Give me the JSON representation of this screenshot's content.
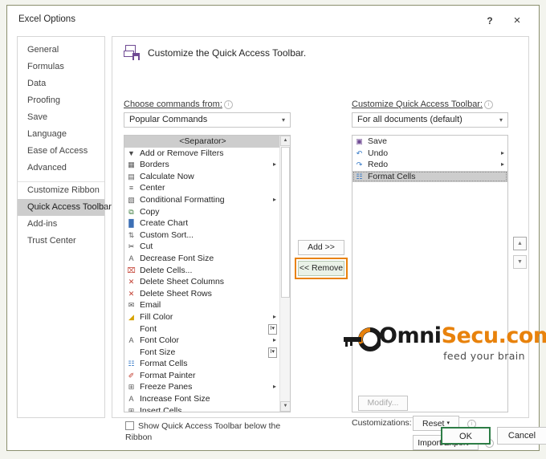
{
  "window": {
    "title": "Excel Options",
    "help_icon": "?",
    "close_icon": "×"
  },
  "sidebar": {
    "items": [
      {
        "label": "General",
        "active": false
      },
      {
        "label": "Formulas",
        "active": false
      },
      {
        "label": "Data",
        "active": false
      },
      {
        "label": "Proofing",
        "active": false
      },
      {
        "label": "Save",
        "active": false
      },
      {
        "label": "Language",
        "active": false
      },
      {
        "label": "Ease of Access",
        "active": false
      },
      {
        "label": "Advanced",
        "active": false
      },
      {
        "label": "Customize Ribbon",
        "active": false
      },
      {
        "label": "Quick Access Toolbar",
        "active": true
      },
      {
        "label": "Add-ins",
        "active": false
      },
      {
        "label": "Trust Center",
        "active": false
      }
    ]
  },
  "main": {
    "header_title": "Customize the Quick Access Toolbar.",
    "header_icon": "print-save-icon",
    "choose_commands_label": "Choose commands from:",
    "choose_commands_value": "Popular Commands",
    "customize_qat_label": "Customize Quick Access Toolbar:",
    "customize_qat_value": "For all documents (default)",
    "commands": [
      {
        "label": "<Separator>",
        "icon": "",
        "separator": true,
        "selected": true
      },
      {
        "label": "Add or Remove Filters",
        "icon": "filter-icon"
      },
      {
        "label": "Borders",
        "icon": "borders-icon",
        "submenu": "▸",
        "split": true
      },
      {
        "label": "Calculate Now",
        "icon": "calculator-icon"
      },
      {
        "label": "Center",
        "icon": "align-center-icon"
      },
      {
        "label": "Conditional Formatting",
        "icon": "conditional-formatting-icon",
        "submenu": "▸"
      },
      {
        "label": "Copy",
        "icon": "copy-icon"
      },
      {
        "label": "Create Chart",
        "icon": "chart-icon"
      },
      {
        "label": "Custom Sort...",
        "icon": "sort-icon"
      },
      {
        "label": "Cut",
        "icon": "scissors-icon"
      },
      {
        "label": "Decrease Font Size",
        "icon": "decrease-font-icon"
      },
      {
        "label": "Delete Cells...",
        "icon": "delete-cells-icon"
      },
      {
        "label": "Delete Sheet Columns",
        "icon": "delete-columns-icon"
      },
      {
        "label": "Delete Sheet Rows",
        "icon": "delete-rows-icon"
      },
      {
        "label": "Email",
        "icon": "email-icon"
      },
      {
        "label": "Fill Color",
        "icon": "fill-color-icon",
        "submenu": "▸",
        "split": true
      },
      {
        "label": "Font",
        "icon": "",
        "combobox": "I▾"
      },
      {
        "label": "Font Color",
        "icon": "font-color-icon",
        "submenu": "▸",
        "split": true
      },
      {
        "label": "Font Size",
        "icon": "",
        "combobox": "I▾"
      },
      {
        "label": "Format Cells",
        "icon": "format-cells-icon"
      },
      {
        "label": "Format Painter",
        "icon": "format-painter-icon"
      },
      {
        "label": "Freeze Panes",
        "icon": "freeze-panes-icon",
        "submenu": "▸"
      },
      {
        "label": "Increase Font Size",
        "icon": "increase-font-icon"
      },
      {
        "label": "Insert Cells...",
        "icon": "insert-cells-icon"
      }
    ],
    "qat_items": [
      {
        "label": "Save",
        "icon": "save-icon",
        "selected": false
      },
      {
        "label": "Undo",
        "icon": "undo-icon",
        "submenu": "▸",
        "selected": false
      },
      {
        "label": "Redo",
        "icon": "redo-icon",
        "submenu": "▸",
        "selected": false
      },
      {
        "label": "Format Cells",
        "icon": "format-cells-icon",
        "selected": true
      }
    ],
    "add_button": "Add >>",
    "remove_button": "<< Remove",
    "move_up_icon": "▲",
    "move_down_icon": "▼",
    "scroll_up_icon": "▲",
    "scroll_down_icon": "▼",
    "checkbox_label": "Show Quick Access Toolbar below the Ribbon",
    "checkbox_checked": false,
    "modify_button": "Modify...",
    "customizations_label": "Customizations:",
    "reset_button": "Reset",
    "import_export_button": "Import/Export",
    "dropdown_caret": "▾",
    "info_icon": "i"
  },
  "watermark": {
    "brand_first": "Omni",
    "brand_second": "Secu.com",
    "tagline": "feed your brain",
    "accent_color": "#e8820c",
    "dark_color": "#1a1a1a"
  },
  "footer": {
    "ok_button": "OK",
    "cancel_button": "Cancel"
  },
  "colors": {
    "highlight_annotation": "#e8820c",
    "selection_gray": "#cdcdcd",
    "ok_focus_green": "#2d7d46",
    "dialog_border": "#8a8f6e"
  }
}
